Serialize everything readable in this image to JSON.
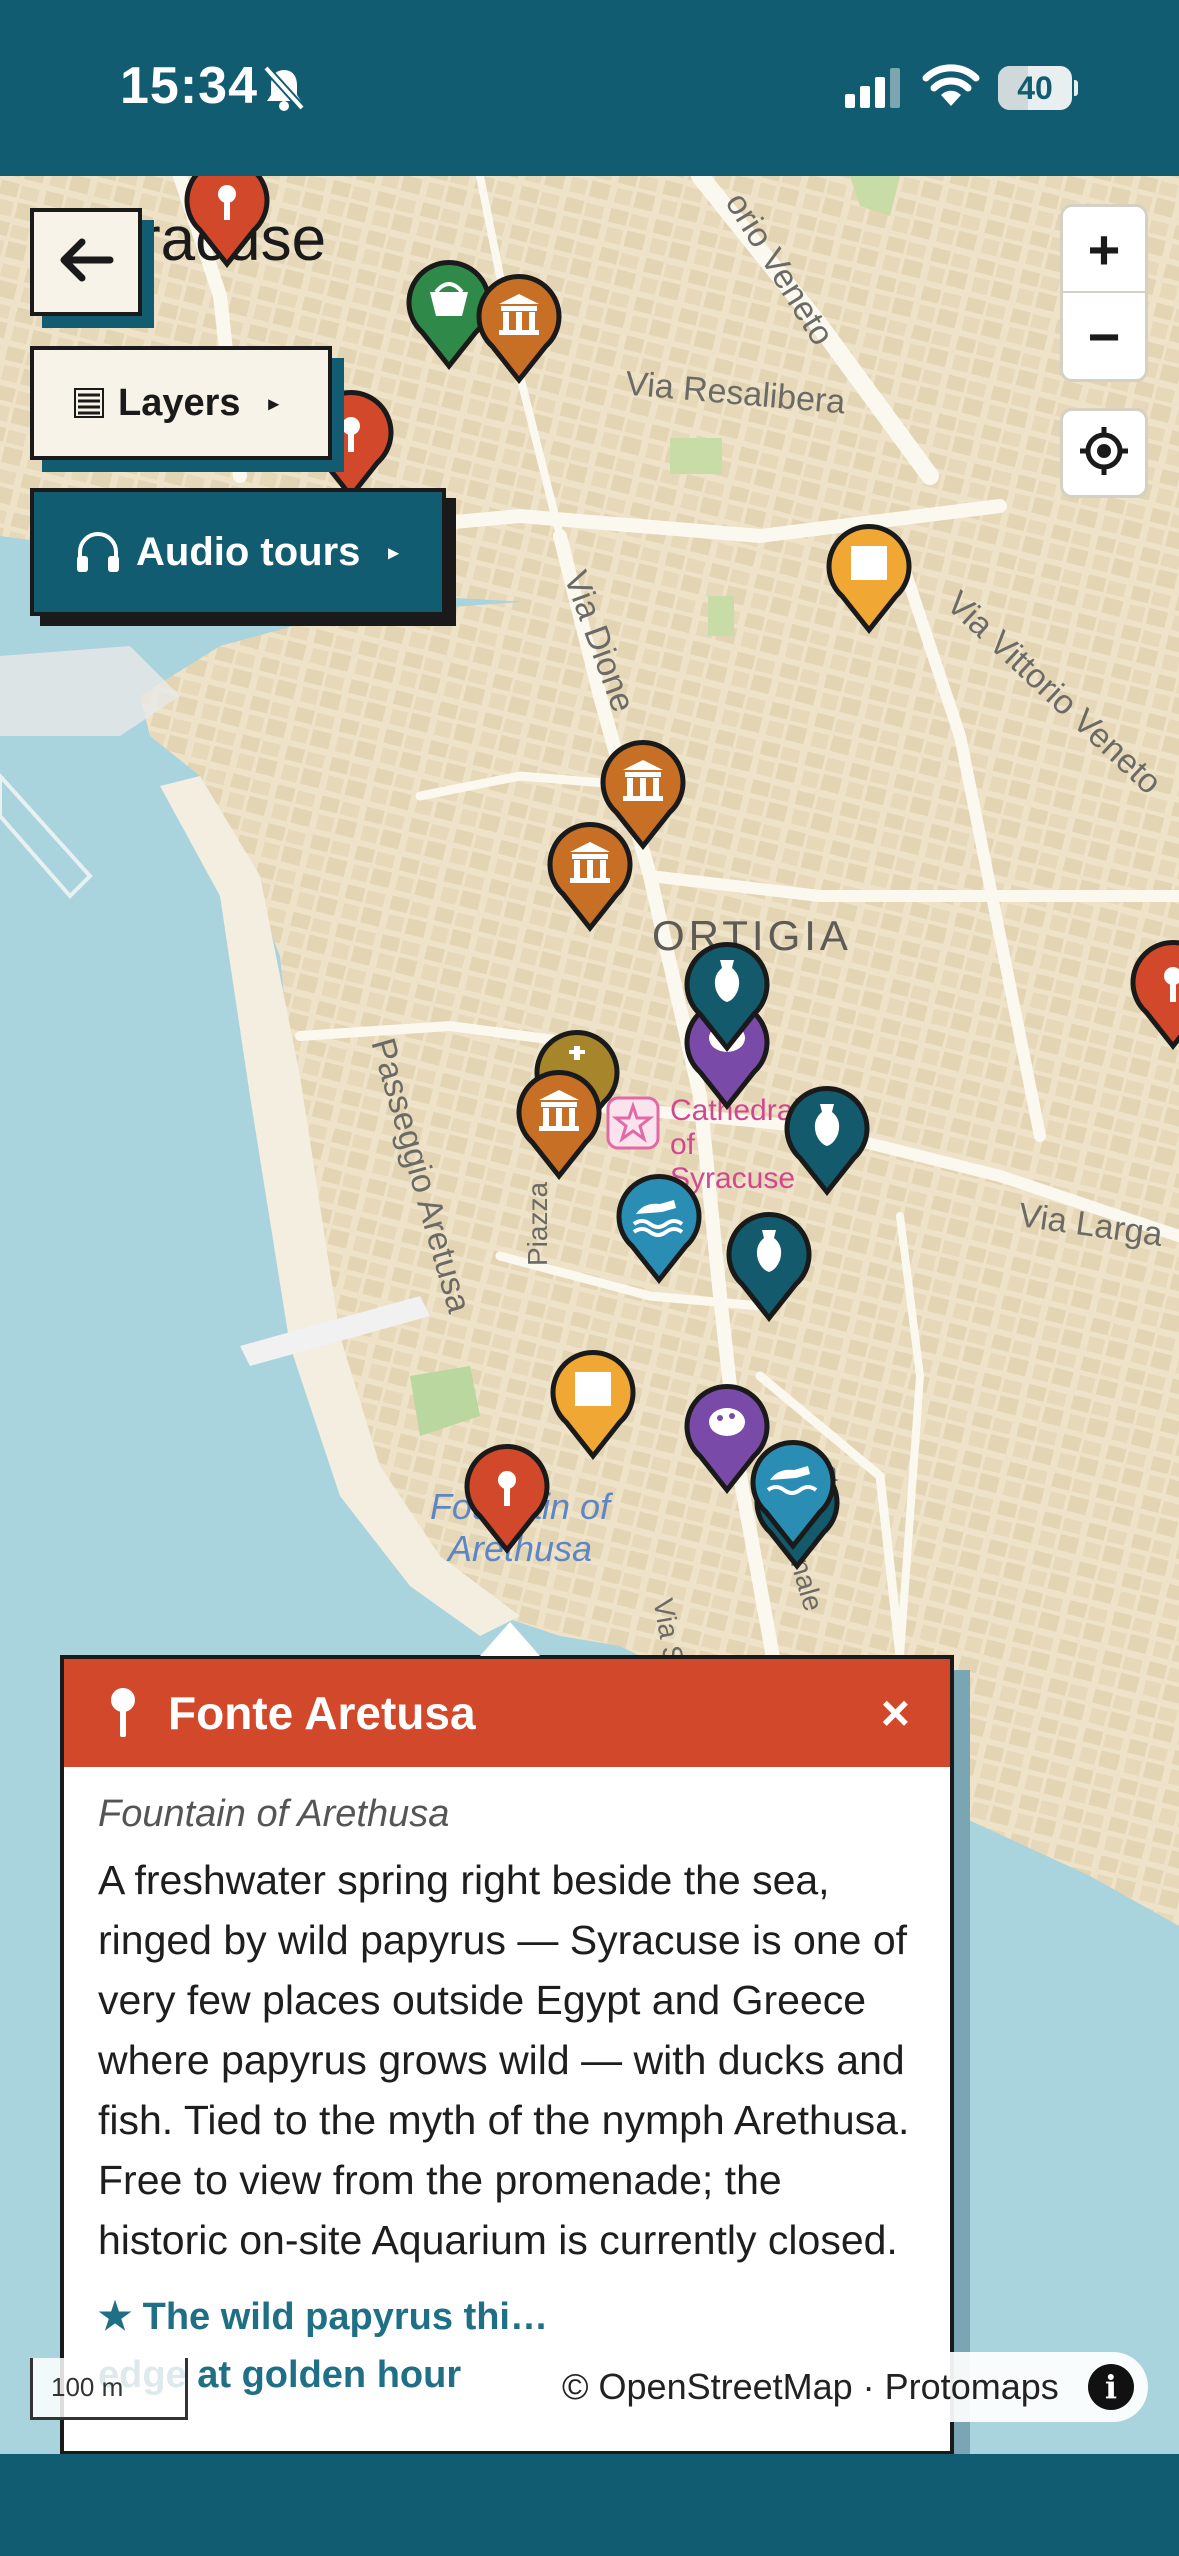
{
  "status": {
    "time": "15:34",
    "battery": "40",
    "battery_level": 0.4
  },
  "colors": {
    "brand": "#115c70",
    "popup_header": "#d2482a",
    "land": "#eee3c8",
    "water": "#a9d3dd"
  },
  "map": {
    "place_labels": {
      "city": "racuse",
      "district": "ORTIGIA",
      "cathedral": "Cathedral of Syracuse",
      "fountain": "Fountain of Arethusa"
    },
    "streets": {
      "corso": "orio Veneto",
      "resalibera": "Via Resalibera",
      "dione": "Via Dione",
      "vittorio": "Via Vittorio Veneto",
      "passeggio": "Passeggio Aretusa",
      "larga": "Via Larga",
      "piazza": "Piazza",
      "via_s": "Via S",
      "rnale": "rnale",
      "vi_a": "a"
    },
    "controls": {
      "back_icon": "arrow-left-icon",
      "layers_label": "Layers",
      "layers_icon": "list-icon",
      "audio_label": "Audio tours",
      "audio_icon": "headphones-icon",
      "zoom_in": "+",
      "zoom_out": "−",
      "locate_icon": "crosshair-icon"
    },
    "scale": "100 m",
    "attribution": "© OpenStreetMap · Protomaps",
    "info_icon": "info-icon"
  },
  "popup": {
    "title": "Fonte Aretusa",
    "subtitle": "Fountain of Arethusa",
    "body": "A freshwater spring right beside the sea, ringed by wild papyrus — Syracuse is one of very few places outside Egypt and Greece where papyrus grows wild — with ducks and fish. Tied to the myth of the nymph Arethusa. Free to view from the promenade; the historic on-site Aquarium is currently closed.",
    "tip": "★ The wild papyrus thi… edge at golden hour",
    "close": "×",
    "icon": "pin-icon"
  }
}
